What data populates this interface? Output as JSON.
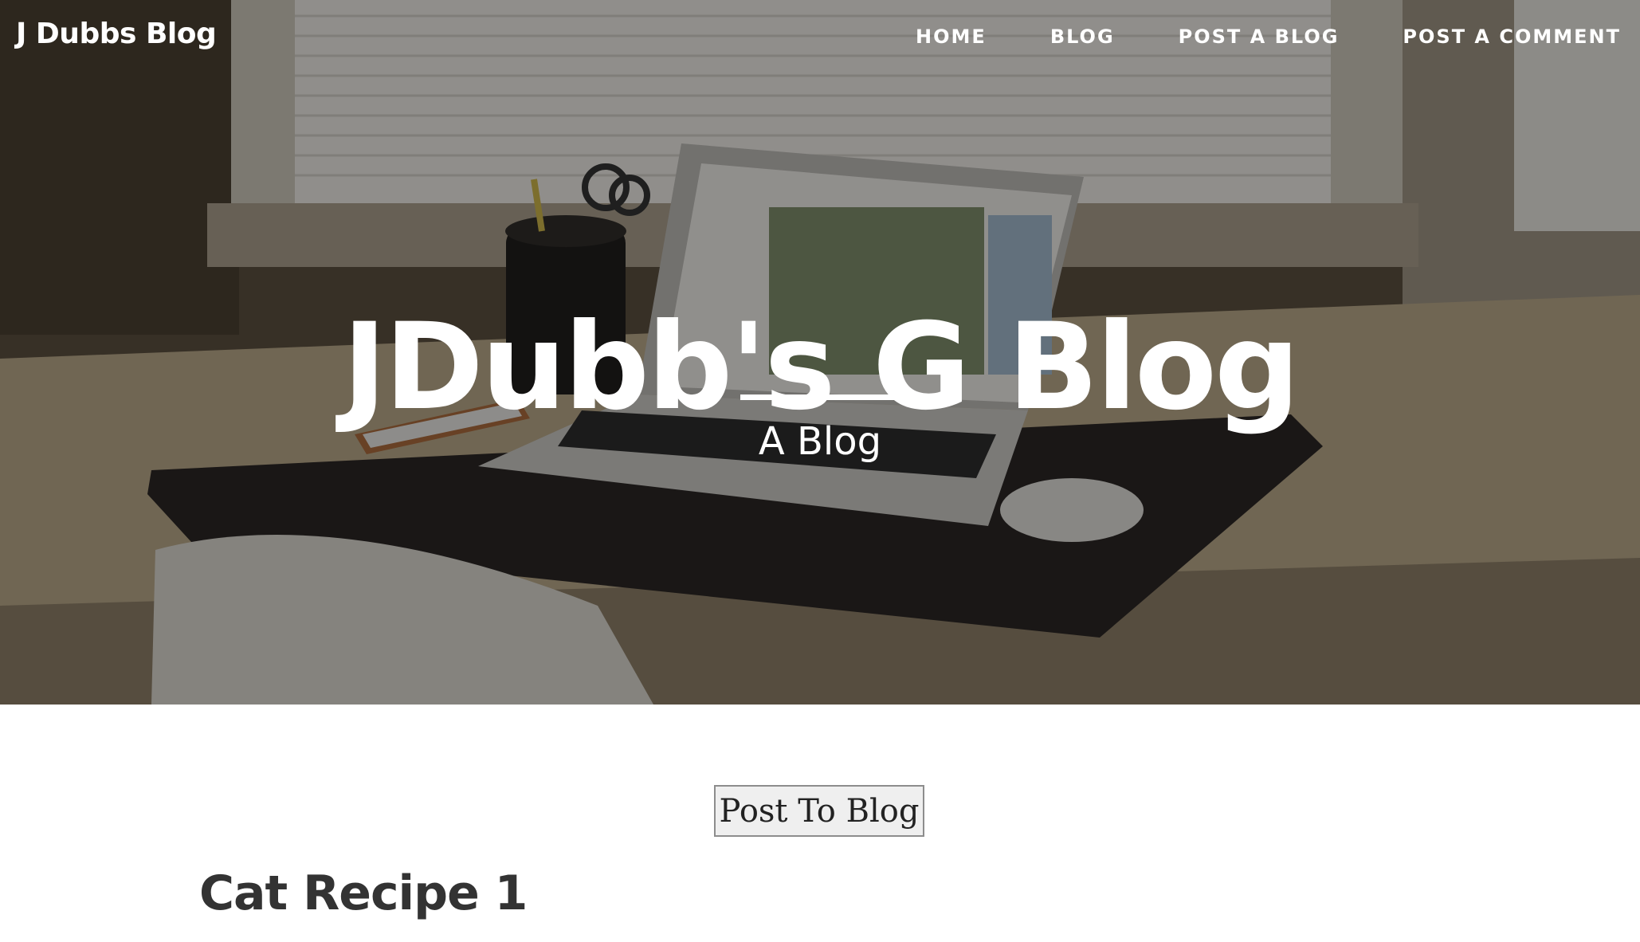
{
  "nav": {
    "brand": "J Dubbs Blog",
    "links": [
      {
        "label": "HOME"
      },
      {
        "label": "BLOG"
      },
      {
        "label": "POST A BLOG"
      },
      {
        "label": "POST A COMMENT"
      }
    ]
  },
  "hero": {
    "heading": "JDubb's G Blog",
    "subheading": "A Blog"
  },
  "content": {
    "post_button_label": "Post To Blog",
    "posts": [
      {
        "title": "Cat Recipe 1"
      }
    ]
  },
  "colors": {
    "nav_text": "#ffffff",
    "hero_overlay": "rgba(0,0,0,0.38)",
    "post_title": "#333333",
    "button_background": "#efefef",
    "button_border": "#8d8d8d"
  },
  "icons": {
    "hero_image": "desk-with-laptop-photo"
  }
}
